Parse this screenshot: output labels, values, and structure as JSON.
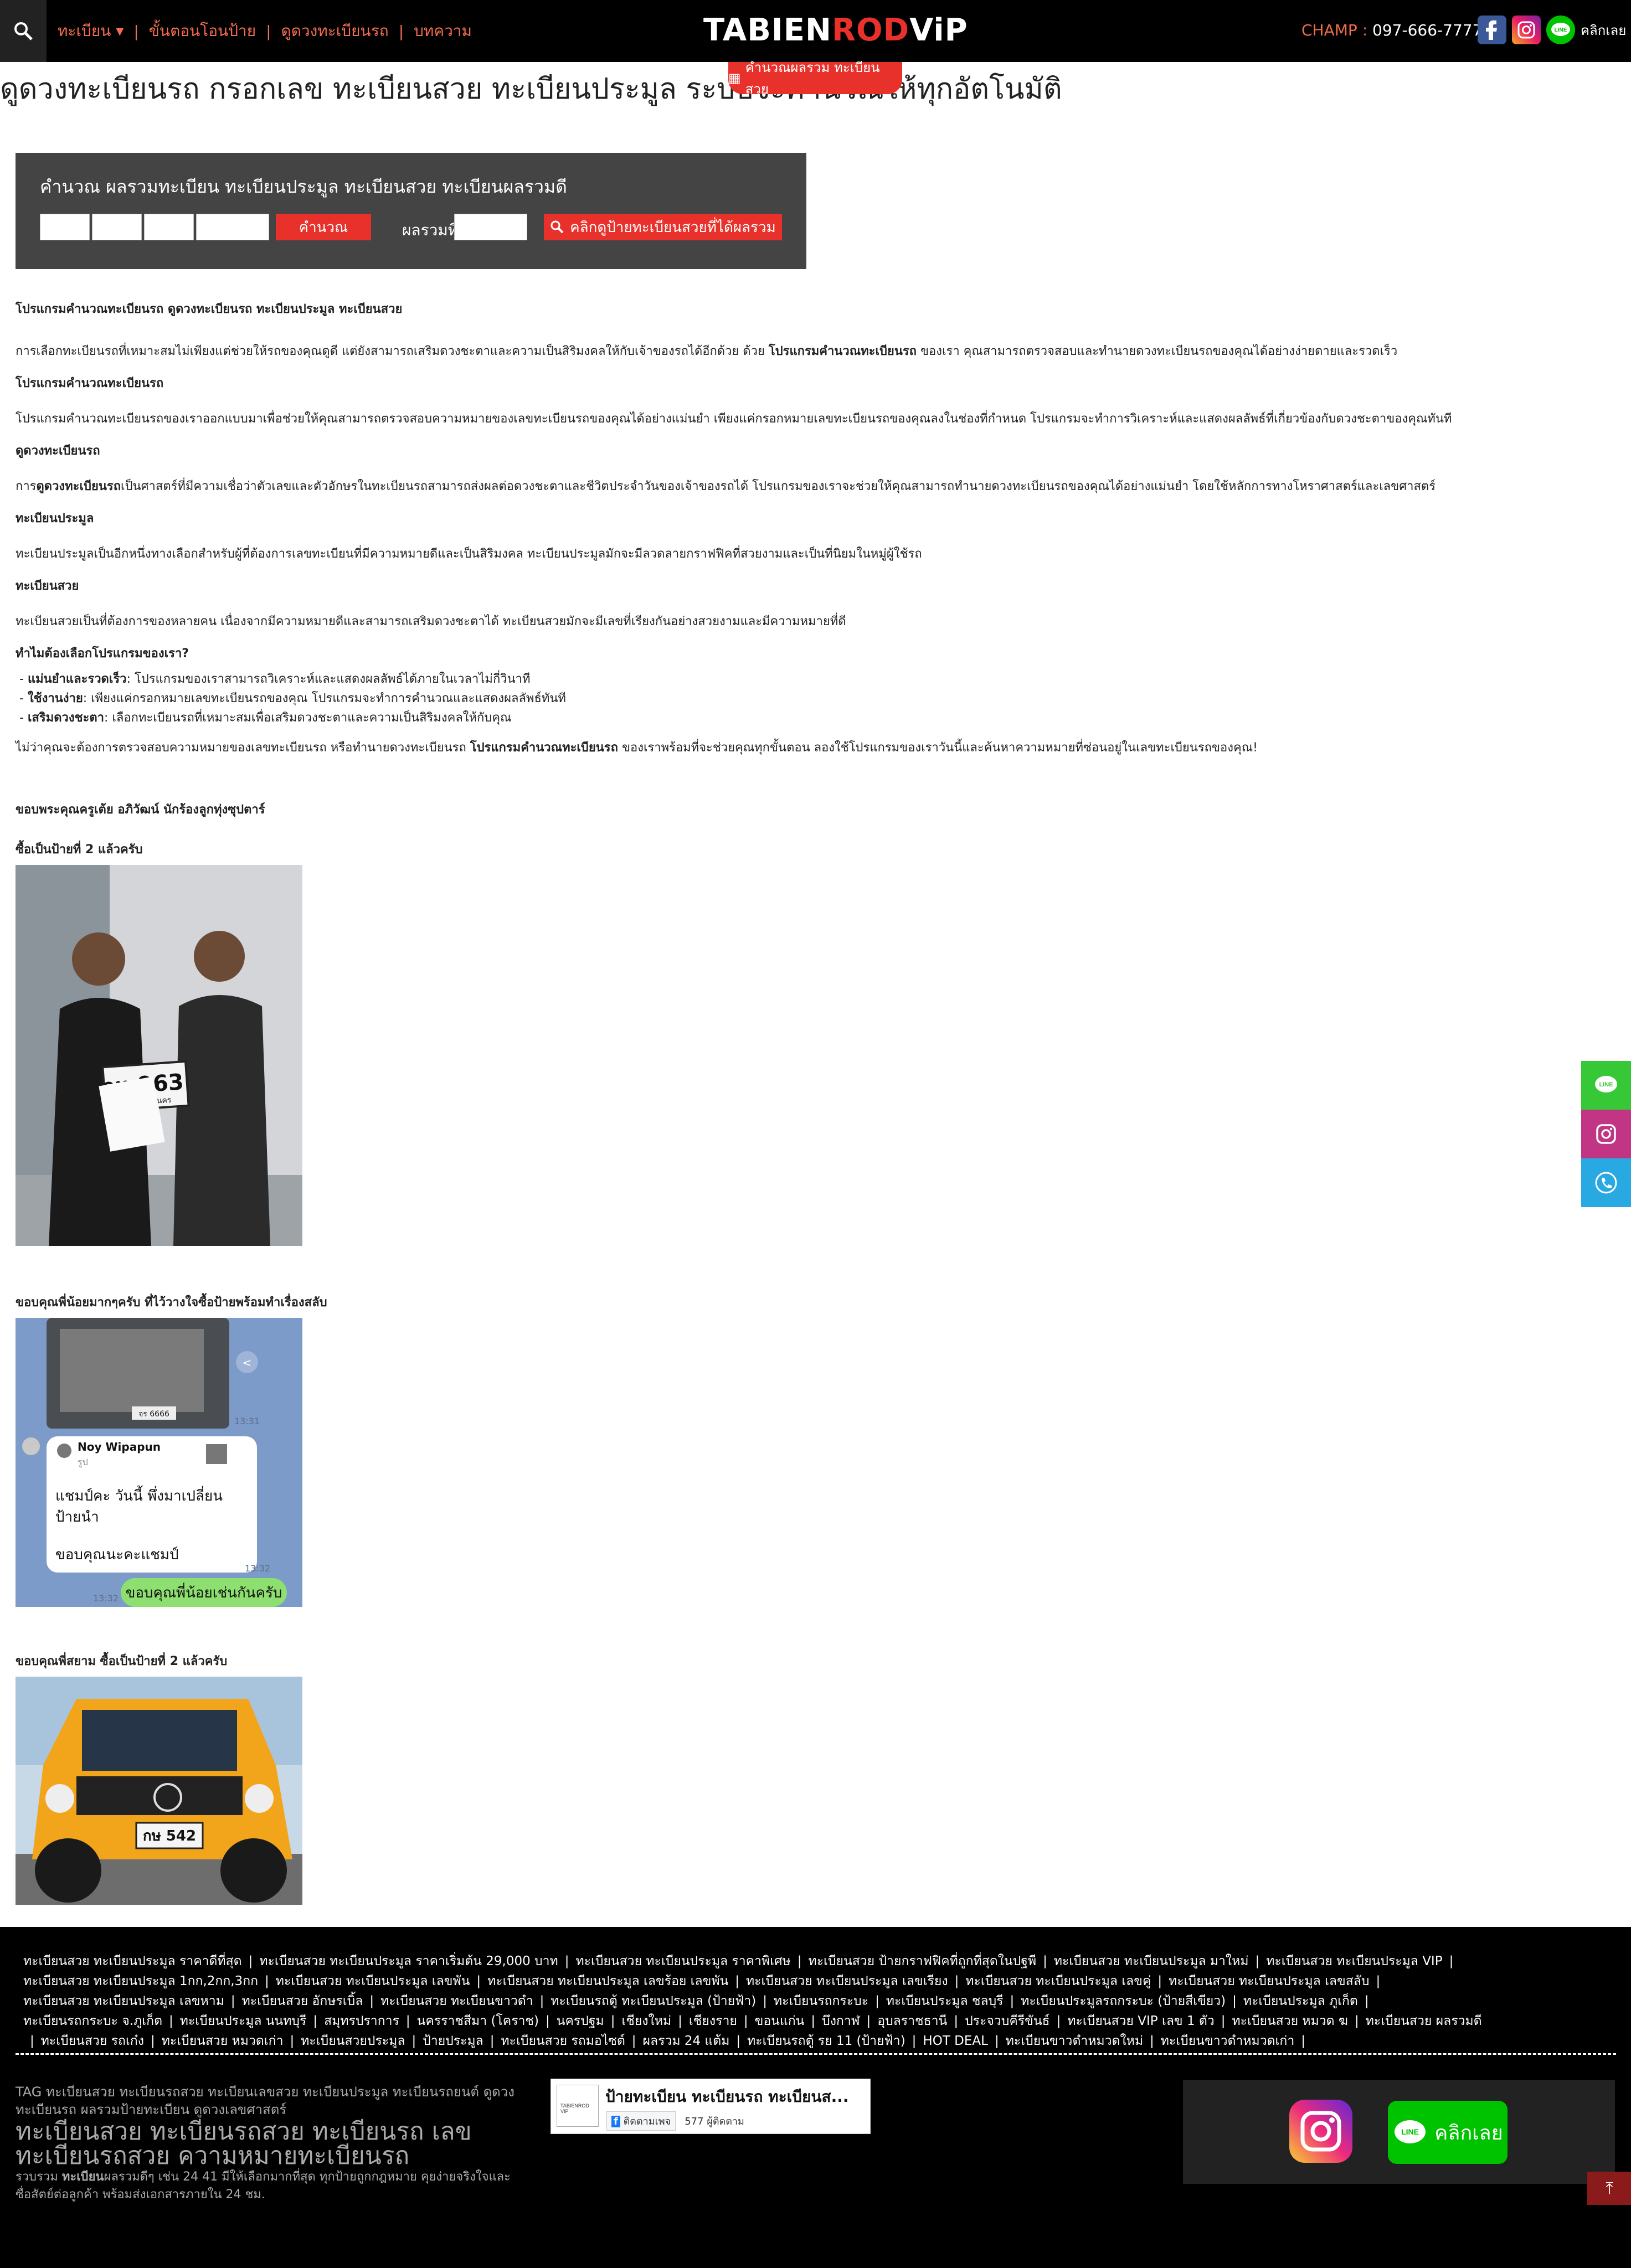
{
  "header": {
    "nav": [
      "ทะเบียน ▾",
      "ขั้นตอนโอนป้าย",
      "ดูดวงทะเบียนรถ",
      "บทความ"
    ],
    "logo_prefix": "TABIEN",
    "logo_red": "ROD",
    "logo_suffix": "ViP",
    "contact_label": "CHAMP :",
    "contact_number": "097-666-7777",
    "social_text": "คลิกเลย",
    "calc_tab": "คำนวณผลรวม ทะเบียนสวย"
  },
  "page_title": "ดูดวงทะเบียนรถ กรอกเลข ทะเบียนสวย ทะเบียนประมูล ระบบจะคำนวณให้ทุกอัตโนมัติ",
  "calculator": {
    "title": "คำนวณ ผลรวมทะเบียน ทะเบียนประมูล ทะเบียนสวย ทะเบียนผลรวมดี",
    "calc_button": "คำนวณ",
    "sum_label": "ผลรวมที่ได้",
    "search_button": "คลิกดูป้ายทะเบียนสวยที่ได้ผลรวม"
  },
  "article": {
    "h_program": "โปรแกรมคำนวณทะเบียนรถ ดูดวงทะเบียนรถ ทะเบียนประมูล ทะเบียนสวย",
    "p1_pre": "การเลือกทะเบียนรถที่เหมาะสมไม่เพียงแต่ช่วยให้รถของคุณดูดี แต่ยังสามารถเสริมดวงชะตาและความเป็นสิริมงคลให้กับเจ้าของรถได้อีกด้วย ด้วย ",
    "p1_bold": "โปรแกรมคำนวณทะเบียนรถ",
    "p1_post": " ของเรา คุณสามารถตรวจสอบและทำนายดวงทะเบียนรถของคุณได้อย่างง่ายดายและรวดเร็ว",
    "h2": "โปรแกรมคำนวณทะเบียนรถ",
    "p2": "โปรแกรมคำนวณทะเบียนรถของเราออกแบบมาเพื่อช่วยให้คุณสามารถตรวจสอบความหมายของเลขทะเบียนรถของคุณได้อย่างแม่นยำ เพียงแค่กรอกหมายเลขทะเบียนรถของคุณลงในช่องที่กำหนด โปรแกรมจะทำการวิเคราะห์และแสดงผลลัพธ์ที่เกี่ยวข้องกับดวงชะตาของคุณทันที",
    "h3": "ดูดวงทะเบียนรถ",
    "p3_pre": "การ",
    "p3_bold": "ดูดวงทะเบียนรถ",
    "p3_post": "เป็นศาสตร์ที่มีความเชื่อว่าตัวเลขและตัวอักษรในทะเบียนรถสามารถส่งผลต่อดวงชะตาและชีวิตประจำวันของเจ้าของรถได้ โปรแกรมของเราจะช่วยให้คุณสามารถทำนายดวงทะเบียนรถของคุณได้อย่างแม่นยำ โดยใช้หลักการทางโหราศาสตร์และเลขศาสตร์",
    "h4": "ทะเบียนประมูล",
    "p4": "ทะเบียนประมูลเป็นอีกหนึ่งทางเลือกสำหรับผู้ที่ต้องการเลขทะเบียนที่มีความหมายดีและเป็นสิริมงคล ทะเบียนประมูลมักจะมีลวดลายกราฟฟิคที่สวยงามและเป็นที่นิยมในหมู่ผู้ใช้รถ",
    "h5": "ทะเบียนสวย",
    "p5": "ทะเบียนสวยเป็นที่ต้องการของหลายคน เนื่องจากมีความหมายดีและสามารถเสริมดวงชะตาได้ ทะเบียนสวยมักจะมีเลขที่เรียงกันอย่างสวยงามและมีความหมายที่ดี",
    "h6": "ทำไมต้องเลือกโปรแกรมของเรา?",
    "li1_bold": "แม่นยำและรวดเร็ว",
    "li1": ": โปรแกรมของเราสามารถวิเคราะห์และแสดงผลลัพธ์ได้ภายในเวลาไม่กี่วินาที",
    "li2_bold": "ใช้งานง่าย",
    "li2": ": เพียงแค่กรอกหมายเลขทะเบียนรถของคุณ โปรแกรมจะทำการคำนวณและแสดงผลลัพธ์ทันที",
    "li3_bold": "เสริมดวงชะตา",
    "li3": ": เลือกทะเบียนรถที่เหมาะสมเพื่อเสริมดวงชะตาและความเป็นสิริมงคลให้กับคุณ",
    "p6_pre": "ไม่ว่าคุณจะต้องการตรวจสอบความหมายของเลขทะเบียนรถ หรือทำนายดวงทะเบียนรถ ",
    "p6_bold": "โปรแกรมคำนวณทะเบียนรถ",
    "p6_post": " ของเราพร้อมที่จะช่วยคุณทุกขั้นตอน ลองใช้โปรแกรมของเราวันนี้และค้นหาความหมายที่ซ่อนอยู่ในเลขทะเบียนรถของคุณ!",
    "t1": "ขอบพระคุณครูเต้ย อภิวัฒน์ นักร้องลูกทุ่งซุปตาร์",
    "t1b": "ซื้อเป็นป้ายที่ 2 แล้วครับ",
    "plate1_top": "กห 963",
    "plate1_bottom": "กรุงเทพมหานคร",
    "t2": "ขอบคุณพี่น้อยมากๆครับ ที่ไว้วางใจซื้อป้ายพร้อมทำเรื่องสลับ",
    "chat_time1": "13:31",
    "chat_name": "Noy Wipapun",
    "chat_sub": "รูป",
    "chat_msg1": "แชมป์คะ วันนี้ พึ่งมาเปลี่ยน ป้ายนำ",
    "chat_msg2": "ขอบคุณนะคะแชมป์",
    "chat_time2": "13:32",
    "chat_time3": "13:32",
    "chat_reply": "ขอบคุณพี่น้อยเช่นกันครับ",
    "t3": "ขอบคุณพี่สยาม ซื้อเป็นป้ายที่ 2 แล้วครับ",
    "plate3": "กษ 542"
  },
  "footer": {
    "tags": [
      "ทะเบียนสวย ทะเบียนประมูล ราคาดีที่สุด",
      "ทะเบียนสวย ทะเบียนประมูล ราคาเริ่มต้น 29,000 บาท",
      "ทะเบียนสวย ทะเบียนประมูล ราคาพิเศษ",
      "ทะเบียนสวย ป้ายกราฟฟิคที่ถูกที่สุดในปฐพี",
      "ทะเบียนสวย ทะเบียนประมูล มาใหม่",
      "ทะเบียนสวย ทะเบียนประมูล VIP",
      "ทะเบียนสวย ทะเบียนประมูล 1กก,2กก,3กก",
      "ทะเบียนสวย ทะเบียนประมูล เลขพัน",
      "ทะเบียนสวย ทะเบียนประมูล เลขร้อย เลขพัน",
      "ทะเบียนสวย ทะเบียนประมูล เลขเรียง",
      "ทะเบียนสวย ทะเบียนประมูล เลขคู่",
      "ทะเบียนสวย ทะเบียนประมูล เลขสลับ",
      "ทะเบียนสวย ทะเบียนประมูล เลขหาม",
      "ทะเบียนสวย อักษรเบิ้ล",
      "ทะเบียนสวย ทะเบียนขาวดำ",
      "ทะเบียนรถตู้ ทะเบียนประมูล (ป้ายฟ้า)",
      "ทะเบียนรถกระบะ",
      "ทะเบียนประมูล ชลบุรี",
      "ทะเบียนประมูลรถกระบะ (ป้ายสีเขียว)",
      "ทะเบียนประมูล ภูเก็ต",
      "ทะเบียนรถกระบะ จ.ภูเก็ต",
      "ทะเบียนประมูล นนทบุรี",
      "สมุทรปราการ",
      "นครราชสีมา (โคราช)",
      "นครปฐม",
      "เชียงใหม่",
      "เชียงราย",
      "ขอนแก่น",
      "บึงกาฬ",
      "อุบลราชธานี",
      "ประจวบคีรีขันธ์",
      "ทะเบียนสวย VIP เลข 1 ตัว",
      "ทะเบียนสวย หมวด ฆ",
      "ทะเบียนสวย ผลรวมดี",
      "ทะเบียนสวย รถเก๋ง",
      "ทะเบียนสวย หมวดเก่า",
      "ทะเบียนสวยประมูล",
      "ป้ายประมูล",
      "ทะเบียนสวย รถมอไซต์",
      "ผลรวม 24 แต้ม",
      "ทะเบียนรถตู้ รย 11 (ป้ายฟ้า)",
      "HOT DEAL",
      "ทะเบียนขาวดำหมวดใหม่",
      "ทะเบียนขาวดำหมวดเก่า"
    ],
    "tag_line": "TAG ทะเบียนสวย ทะเบียนรถสวย ทะเบียนเลขสวย ทะเบียนประมูล ทะเบียนรถยนต์ ดูดวงทะเบียนรถ ผลรวมป้ายทะเบียน ดูดวงเลขศาสตร์",
    "big_title": "ทะเบียนสวย ทะเบียนรถสวย ทะเบียนรถ เลขทะเบียนรถสวย ความหมายทะเบียนรถ",
    "desc_pre": "รวบรวม ",
    "desc_bold": "ทะเบียน",
    "desc_post": "ผลรวมดีๆ เช่น 24 41 มีให้เลือกมากที่สุด ทุกป้ายถูกกฎหมาย คุยง่ายจริงใจและซื่อสัตย์ต่อลูกค้า พร้อมส่งเอกสารภายใน 24 ชม.",
    "fb_page": "ป้ายทะเบียน ทะเบียนรถ ทะเบียนส...",
    "fb_follow": "ติดตามเพจ",
    "fb_count": "577 ผู้ติดตาม",
    "line_btn": "คลิกเลย"
  },
  "colors": {
    "accent": "#e8312b",
    "nav": "#f26c4f",
    "line": "#00c300",
    "sidebar_line": "#37c837",
    "sidebar_ig": "#c13584",
    "sidebar_phone": "#29a9e1"
  }
}
